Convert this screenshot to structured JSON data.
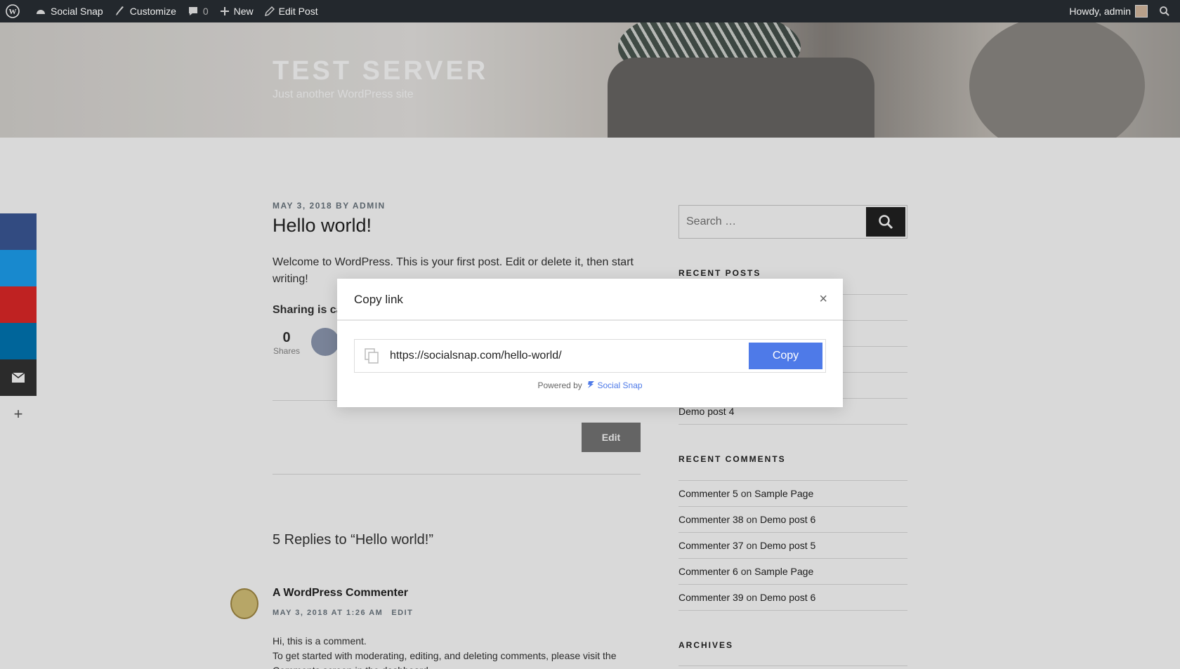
{
  "admin_bar": {
    "site_name": "Social Snap",
    "customize": "Customize",
    "comments_count": "0",
    "new": "New",
    "edit_post": "Edit Post",
    "greeting": "Howdy, admin"
  },
  "header": {
    "title": "TEST SERVER",
    "description": "Just another WordPress site"
  },
  "post": {
    "meta": "MAY 3, 2018 BY ADMIN",
    "title": "Hello world!",
    "text": "Welcome to WordPress. This is your first post. Edit or delete it, then start writing!",
    "sharing": "Sharing is ca",
    "share_count": "0",
    "share_label": "Shares",
    "edit_label": "Edit"
  },
  "comments": {
    "heading": "5 Replies to “Hello world!”",
    "author": "A WordPress Commenter",
    "date": "MAY 3, 2018 AT 1:26 AM",
    "edit": "EDIT",
    "text_line1": "Hi, this is a comment.",
    "text_line2": "To get started with moderating, editing, and deleting comments, please visit the",
    "text_line3": "Comments screen in the dashboard."
  },
  "sidebar": {
    "search_placeholder": "Search …",
    "recent_posts_title": "RECENT POSTS",
    "recent_posts_visible": [
      "Demo post 4"
    ],
    "recent_comments_title": "RECENT COMMENTS",
    "recent_comments": [
      {
        "author": "Commenter 5",
        "on": "on",
        "post": "Sample Page"
      },
      {
        "author": "Commenter 38",
        "on": "on",
        "post": "Demo post 6"
      },
      {
        "author": "Commenter 37",
        "on": "on",
        "post": "Demo post 5"
      },
      {
        "author": "Commenter 6",
        "on": "on",
        "post": "Sample Page"
      },
      {
        "author": "Commenter 39",
        "on": "on",
        "post": "Demo post 6"
      }
    ],
    "archives_title": "ARCHIVES"
  },
  "floating_share": {
    "colors": [
      "#3b5998",
      "#1da1f2",
      "#e12828",
      "#0077b5",
      "#333333"
    ],
    "more": "+"
  },
  "modal": {
    "title": "Copy link",
    "close": "×",
    "url": "https://socialsnap.com/hello-world/",
    "copy_label": "Copy",
    "powered_by": "Powered by",
    "brand": "Social Snap"
  }
}
